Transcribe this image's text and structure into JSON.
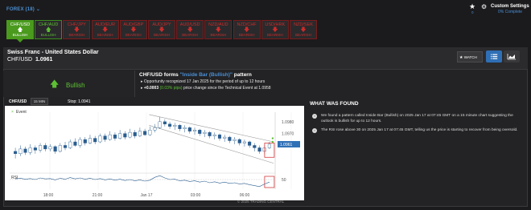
{
  "forex_dropdown": "FOREX (18) ⌄",
  "watchlist_count": "0",
  "settings": {
    "title": "Custom Settings",
    "progress_text": "0% Complete"
  },
  "tiles": [
    {
      "symbol": "CHF/USD",
      "trend": "BULLISH",
      "bullish": true,
      "active": true
    },
    {
      "symbol": "CHF/AUD",
      "trend": "BULLISH",
      "bullish": true,
      "active": false
    },
    {
      "symbol": "CHF/JPY",
      "trend": "BEARISH",
      "bullish": false,
      "active": false
    },
    {
      "symbol": "AUD/EUR",
      "trend": "BEARISH",
      "bullish": false,
      "active": false
    },
    {
      "symbol": "AUD/GBP",
      "trend": "BEARISH",
      "bullish": false,
      "active": false
    },
    {
      "symbol": "AUD/JPY",
      "trend": "BEARISH",
      "bullish": false,
      "active": false
    },
    {
      "symbol": "AUD/USD",
      "trend": "BEARISH",
      "bullish": false,
      "active": false
    },
    {
      "symbol": "NZD/AUD",
      "trend": "BEARISH",
      "bullish": false,
      "active": false
    },
    {
      "symbol": "NZD/CHF",
      "trend": "BEARISH",
      "bullish": false,
      "active": false
    },
    {
      "symbol": "USD/HRK",
      "trend": "BEARISH",
      "bullish": false,
      "active": false
    },
    {
      "symbol": "NZD/SEK",
      "trend": "BEARISH",
      "bullish": false,
      "active": false
    }
  ],
  "instrument": {
    "name": "Swiss Franc - United States Dollar",
    "code": "CHF/USD",
    "price": "1.0961"
  },
  "watch_label": "WATCH",
  "pattern": {
    "direction": "Bullish",
    "title_prefix": "CHF/USD forms ",
    "title_highlight": "\"Inside Bar (Bullish)\"",
    "title_suffix": " pattern",
    "opportunity": "Opportunity recognized 17 Jan 2025 for the period of up to 12 hours",
    "change_value": "+0.0003",
    "change_pips": "(0.03% pips)",
    "change_suffix": " price change since the Technical Event at 1.0958"
  },
  "chart_toolbar": {
    "symbol": "CHF/USD",
    "timeframe": "15 MIN",
    "stop": "Stop: 1.0941"
  },
  "chart_data": {
    "type": "candlestick",
    "x_ticks": [
      "18:00",
      "21:00",
      "Jan 17",
      "03:00",
      "06:00"
    ],
    "y_ticks": [
      "1.0980",
      "1.0970"
    ],
    "y_range": [
      1.0938,
      1.0988
    ],
    "current_price": "1.0961",
    "stop": "1.0941",
    "event_legend": "Event",
    "rsi_label": "RSI",
    "rsi_level": "50",
    "candles": [
      [
        1.0955,
        1.0953,
        1.0958,
        1.0949
      ],
      [
        1.0953,
        1.0957,
        1.096,
        1.0951
      ],
      [
        1.0957,
        1.0954,
        1.0959,
        1.0952
      ],
      [
        1.0954,
        1.0958,
        1.0961,
        1.0952
      ],
      [
        1.0958,
        1.0956,
        1.096,
        1.0953
      ],
      [
        1.0956,
        1.096,
        1.0962,
        1.0954
      ],
      [
        1.096,
        1.0957,
        1.0962,
        1.0955
      ],
      [
        1.0957,
        1.0959,
        1.0961,
        1.0955
      ],
      [
        1.0959,
        1.0955,
        1.096,
        1.0953
      ],
      [
        1.0955,
        1.096,
        1.0962,
        1.0954
      ],
      [
        1.096,
        1.0958,
        1.0963,
        1.0956
      ],
      [
        1.0958,
        1.0963,
        1.0965,
        1.0957
      ],
      [
        1.0963,
        1.096,
        1.0966,
        1.0959
      ],
      [
        1.096,
        1.0965,
        1.0967,
        1.0958
      ],
      [
        1.0965,
        1.0962,
        1.0967,
        1.096
      ],
      [
        1.0962,
        1.0966,
        1.0969,
        1.0961
      ],
      [
        1.0966,
        1.0963,
        1.0968,
        1.0961
      ],
      [
        1.0963,
        1.0968,
        1.097,
        1.0962
      ],
      [
        1.0968,
        1.0965,
        1.097,
        1.0963
      ],
      [
        1.0965,
        1.0969,
        1.0972,
        1.0964
      ],
      [
        1.0969,
        1.0966,
        1.0971,
        1.0964
      ],
      [
        1.0966,
        1.097,
        1.0973,
        1.0965
      ],
      [
        1.097,
        1.0967,
        1.0972,
        1.0965
      ],
      [
        1.0967,
        1.0971,
        1.0974,
        1.0966
      ],
      [
        1.0971,
        1.0968,
        1.0973,
        1.0966
      ],
      [
        1.0968,
        1.0972,
        1.0975,
        1.0967
      ],
      [
        1.0972,
        1.0969,
        1.0974,
        1.0968
      ],
      [
        1.0969,
        1.0973,
        1.0976,
        1.0968
      ],
      [
        1.0973,
        1.0975,
        1.0978,
        1.0971
      ],
      [
        1.0975,
        1.098,
        1.0984,
        1.0974
      ],
      [
        1.098,
        1.0978,
        1.0982,
        1.0976
      ],
      [
        1.0978,
        1.0976,
        1.098,
        1.0974
      ],
      [
        1.0976,
        1.0977,
        1.0979,
        1.0973
      ],
      [
        1.0977,
        1.0974,
        1.0978,
        1.0972
      ],
      [
        1.0974,
        1.0975,
        1.0977,
        1.0971
      ],
      [
        1.0975,
        1.0972,
        1.0976,
        1.097
      ],
      [
        1.0972,
        1.0973,
        1.0975,
        1.0969
      ],
      [
        1.0973,
        1.097,
        1.0974,
        1.0968
      ],
      [
        1.097,
        1.0971,
        1.0973,
        1.0967
      ],
      [
        1.0971,
        1.0968,
        1.0972,
        1.0966
      ],
      [
        1.0968,
        1.0969,
        1.0971,
        1.0965
      ],
      [
        1.0969,
        1.0966,
        1.097,
        1.0964
      ],
      [
        1.0966,
        1.0967,
        1.0969,
        1.0963
      ],
      [
        1.0967,
        1.0964,
        1.0968,
        1.0962
      ],
      [
        1.0964,
        1.0965,
        1.0967,
        1.0961
      ],
      [
        1.0965,
        1.0962,
        1.0966,
        1.096
      ],
      [
        1.0962,
        1.0963,
        1.0965,
        1.0959
      ],
      [
        1.0963,
        1.096,
        1.0964,
        1.0958
      ],
      [
        1.096,
        1.0958,
        1.0962,
        1.0955
      ],
      [
        1.0958,
        1.0955,
        1.096,
        1.0953
      ],
      [
        1.0955,
        1.0958,
        1.096,
        1.0953
      ],
      [
        1.0958,
        1.0961,
        1.0963,
        1.0957
      ]
    ],
    "rsi": [
      52,
      54,
      51,
      53,
      50,
      55,
      52,
      53,
      49,
      54,
      51,
      56,
      52,
      55,
      51,
      54,
      50,
      53,
      49,
      52,
      48,
      51,
      47,
      50,
      46,
      49,
      45,
      48,
      57,
      62,
      55,
      50,
      51,
      46,
      48,
      44,
      46,
      42,
      45,
      40,
      43,
      39,
      42,
      38,
      40,
      36,
      38,
      34,
      31,
      28,
      36,
      42
    ]
  },
  "what_found": {
    "title": "WHAT WAS FOUND",
    "items": [
      "We found a pattern called Inside Bar (Bullish) on 2025 Jan 17 at 07:45 GMT on a 15 minute chart suggesting the outlook is bullish for up to 12 hours.",
      "The RSI rose above 30 on 2025 Jan 17 at 07:45 GMT, telling us the price is starting to recover from being oversold."
    ]
  },
  "copyright": "© 2025 TRADING CENTRAL"
}
